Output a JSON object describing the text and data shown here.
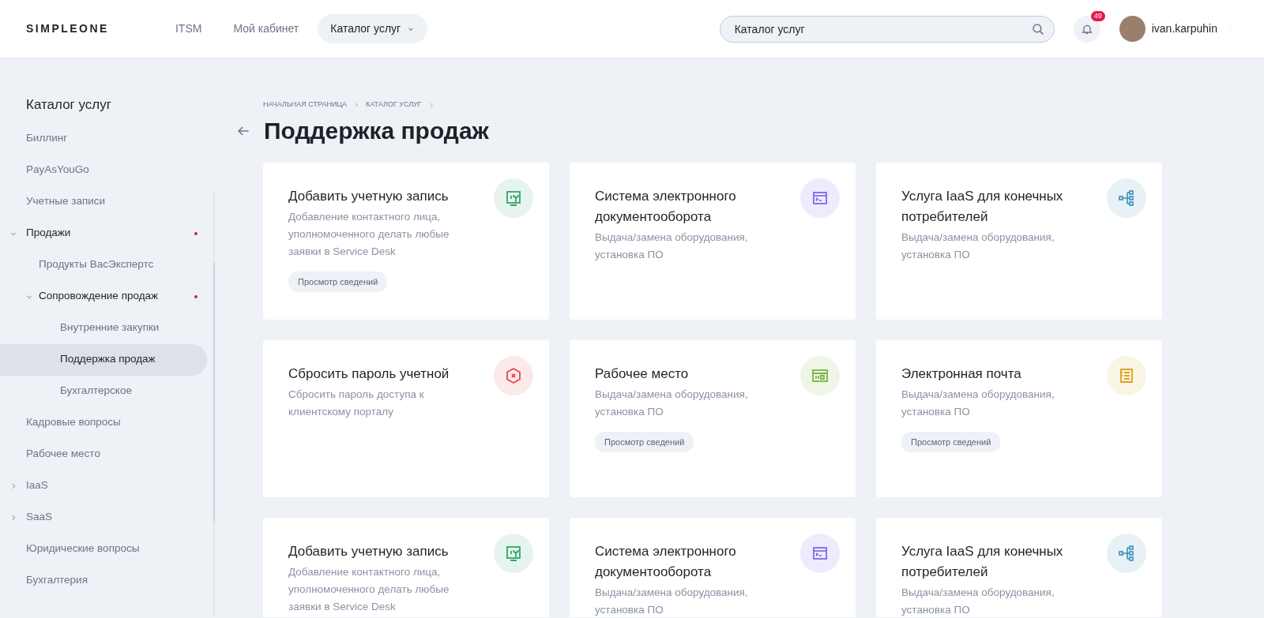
{
  "header": {
    "logo": "SIMPLEONE",
    "nav": [
      {
        "label": "ITSM",
        "selected": false,
        "dropdown": false
      },
      {
        "label": "Мой кабинет",
        "selected": false,
        "dropdown": false
      },
      {
        "label": "Каталог услуг",
        "selected": true,
        "dropdown": true
      }
    ],
    "search": {
      "value": "Каталог услуг"
    },
    "notifications": {
      "count": "49"
    },
    "user": {
      "name": "ivan.karpuhin"
    }
  },
  "sidebar": {
    "title": "Каталог услуг",
    "items": [
      {
        "label": "Биллинг",
        "selected": false
      },
      {
        "label": "PayAsYouGo",
        "selected": false
      },
      {
        "label": "Учетные записи",
        "selected": false
      },
      {
        "label": "Продажи",
        "selected": false,
        "expanded": true,
        "marked": true,
        "children": [
          {
            "label": "Продукты ВасЭкспертс",
            "selected": false
          },
          {
            "label": "Сопровождение продаж",
            "selected": false,
            "expanded": true,
            "marked": true,
            "children": [
              {
                "label": "Внутренние закупки",
                "selected": false
              },
              {
                "label": "Поддержка продаж",
                "selected": true
              },
              {
                "label": "Бухгалтерское",
                "selected": false
              }
            ]
          }
        ]
      },
      {
        "label": "Кадровые вопросы",
        "selected": false
      },
      {
        "label": "Рабочее место",
        "selected": false
      },
      {
        "label": "IaaS",
        "selected": false,
        "expanded": false
      },
      {
        "label": "SaaS",
        "selected": false,
        "expanded": false
      },
      {
        "label": "Юридические вопросы",
        "selected": false
      },
      {
        "label": "Бухгалтерия",
        "selected": false
      }
    ]
  },
  "breadcrumbs": [
    "НАЧАЛЬНАЯ СТРАНИЦА",
    "КАТАЛОГ УСЛУГ"
  ],
  "page_title": "Поддержка продаж",
  "cards": [
    {
      "title": "Добавить учетную запись",
      "description": "Добавление контактного лица, уполномоченного делать любые заявки в Service Desk",
      "kind": "tool",
      "color": "#2fa86b",
      "action": "Просмотр сведений"
    },
    {
      "title": "Система электронного документооборота",
      "description": "Выдача/замена оборудования, установка ПО",
      "kind": "terminal",
      "color": "#6b5ce7"
    },
    {
      "title": "Услуга IaaS для конечных потребителей",
      "description": "Выдача/замена оборудования, установка ПО",
      "kind": "network",
      "color": "#3a8fb7"
    },
    {
      "title": "Сбросить пароль учетной",
      "description": "Сбросить пароль доступа к клиентскому порталу",
      "kind": "hexagon",
      "color": "#e5484d"
    },
    {
      "title": "Рабочее место",
      "description": "Выдача/замена оборудования, установка ПО",
      "kind": "panel",
      "color": "#7cb342",
      "action": "Просмотр сведений"
    },
    {
      "title": "Электронная почта",
      "description": "Выдача/замена оборудования, установка ПО",
      "kind": "document",
      "color": "#d9a520",
      "action": "Просмотр сведений"
    },
    {
      "title": "Добавить учетную запись",
      "description": "Добавление контактного лица, уполномоченного делать любые заявки в Service Desk",
      "kind": "tool",
      "color": "#2fa86b"
    },
    {
      "title": "Система электронного документооборота",
      "description": "Выдача/замена оборудования, установка ПО",
      "kind": "terminal",
      "color": "#6b5ce7"
    },
    {
      "title": "Услуга IaaS для конечных потребителей",
      "description": "Выдача/замена оборудования, установка ПО",
      "kind": "network",
      "color": "#3a8fb7"
    }
  ]
}
